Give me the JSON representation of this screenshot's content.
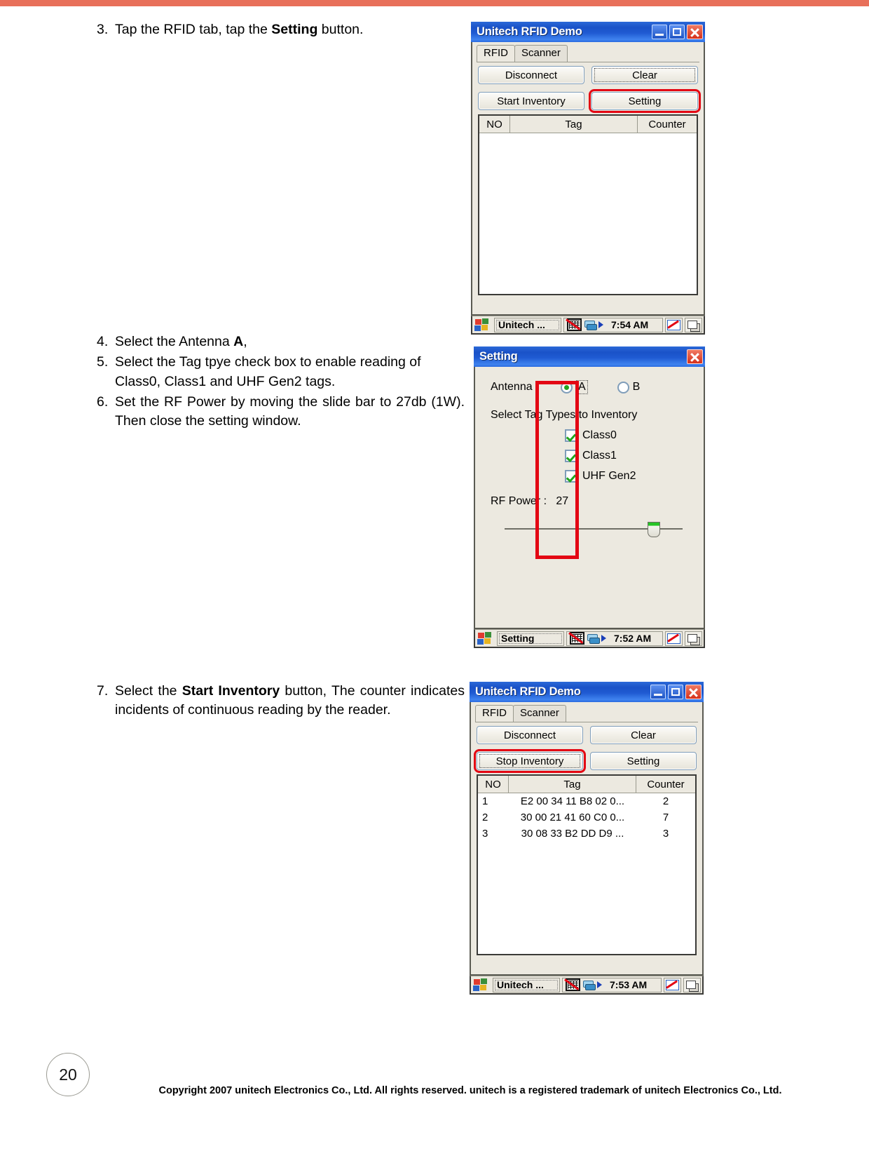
{
  "document": {
    "page_number": "20",
    "copyright": "Copyright 2007 unitech Electronics Co., Ltd. All rights reserved. unitech is a registered trademark of unitech Electronics Co., Ltd."
  },
  "instructions_a": {
    "steps": [
      {
        "num": "3.",
        "text_before": "Tap the RFID tab, tap the ",
        "bold": "Setting",
        "text_after": " button."
      }
    ]
  },
  "instructions_b": {
    "steps": [
      {
        "num": "4.",
        "text_before": "Select the Antenna ",
        "bold": "A",
        "text_after": ","
      },
      {
        "num": "5.",
        "text_before": "Select the Tag tpye check box to enable reading of Class0, Class1 and UHF Gen2 tags.",
        "bold": "",
        "text_after": ""
      },
      {
        "num": "6.",
        "text_before": "Set the RF Power by moving the slide bar to 27db (1W). Then close the setting window.",
        "bold": "",
        "text_after": ""
      }
    ]
  },
  "instructions_c": {
    "steps": [
      {
        "num": "7.",
        "text_before": "Select the ",
        "bold": "Start Inventory",
        "text_after": " button, The counter indicates incidents of continuous reading by the reader."
      }
    ]
  },
  "window_rfid_idle": {
    "title": "Unitech RFID Demo",
    "tabs": [
      {
        "label": "RFID",
        "active": true
      },
      {
        "label": "Scanner",
        "active": false
      }
    ],
    "buttons": {
      "disconnect": "Disconnect",
      "clear": "Clear",
      "start_inventory": "Start Inventory",
      "setting": "Setting"
    },
    "grid": {
      "headers": [
        "NO",
        "Tag",
        "Counter"
      ],
      "rows": []
    },
    "taskbar": {
      "task_label": "Unitech ...",
      "time": "7:54 AM"
    }
  },
  "window_setting": {
    "title": "Setting",
    "antenna": {
      "label": "Antenna",
      "options": [
        {
          "label": "A",
          "checked": true
        },
        {
          "label": "B",
          "checked": false
        }
      ]
    },
    "tag_types": {
      "label": "Select Tag Types to Inventory",
      "items": [
        {
          "label": "Class0",
          "checked": true
        },
        {
          "label": "Class1",
          "checked": true
        },
        {
          "label": "UHF Gen2",
          "checked": true
        }
      ]
    },
    "rf_power": {
      "label": "RF Power :",
      "value": "27",
      "slider_percent": 84
    },
    "taskbar": {
      "task_label": "Setting",
      "time": "7:52 AM"
    }
  },
  "window_rfid_running": {
    "title": "Unitech RFID Demo",
    "tabs": [
      {
        "label": "RFID",
        "active": true
      },
      {
        "label": "Scanner",
        "active": false
      }
    ],
    "buttons": {
      "disconnect": "Disconnect",
      "clear": "Clear",
      "stop_inventory": "Stop Inventory",
      "setting": "Setting"
    },
    "grid": {
      "headers": [
        "NO",
        "Tag",
        "Counter"
      ],
      "rows": [
        {
          "no": "1",
          "tag": "E2 00 34 11 B8 02 0...",
          "counter": "2"
        },
        {
          "no": "2",
          "tag": "30 00 21 41 60 C0 0...",
          "counter": "7"
        },
        {
          "no": "3",
          "tag": "30 08 33 B2 DD D9 ...",
          "counter": "3"
        }
      ]
    },
    "taskbar": {
      "task_label": "Unitech ...",
      "time": "7:53 AM"
    }
  },
  "colors": {
    "accent_top": "#e8705a",
    "highlight": "#e30613",
    "titlebar": "#1f5ad2",
    "window_face": "#ece9e0"
  }
}
